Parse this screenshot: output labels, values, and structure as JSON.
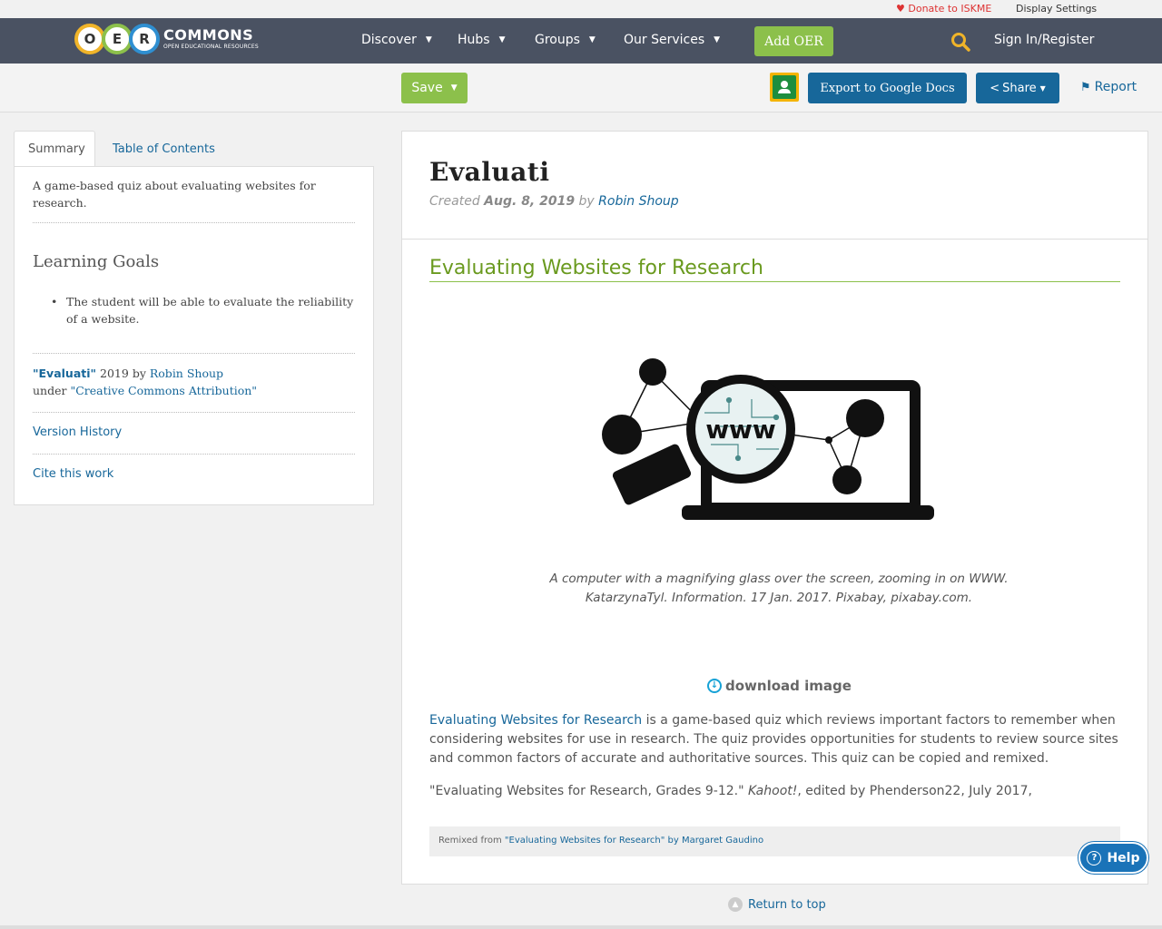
{
  "util": {
    "donate": "Donate to ISKME",
    "display_settings": "Display Settings"
  },
  "logo": {
    "letters": [
      "O",
      "E",
      "R"
    ],
    "word": "COMMONS",
    "sub": "OPEN EDUCATIONAL RESOURCES"
  },
  "nav": {
    "items": [
      "Discover",
      "Hubs",
      "Groups",
      "Our Services"
    ],
    "add_oer": "Add OER",
    "sign_in": "Sign In/Register"
  },
  "actions": {
    "save": "Save",
    "export": "Export to Google Docs",
    "share": "Share",
    "report": "Report"
  },
  "sidebar": {
    "tabs": [
      "Summary",
      "Table of Contents"
    ],
    "summary": "A game-based quiz about evaluating websites for research.",
    "goals_heading": "Learning Goals",
    "goals": [
      "The student will be able to evaluate the reliability of a website."
    ],
    "attribution": {
      "title": "\"Evaluati\"",
      "year": "2019",
      "by": "by",
      "author": "Robin Shoup",
      "under": "under",
      "license": "\"Creative Commons Attribution\""
    },
    "version_history": "Version History",
    "cite": "Cite this work"
  },
  "main": {
    "title": "Evaluati",
    "created_label": "Created",
    "created_date": "Aug. 8, 2019",
    "by": "by",
    "author": "Robin Shoup",
    "section_title": "Evaluating Websites for Research",
    "hero_text": "www",
    "caption_line1": "A computer with a magnifying glass over the screen, zooming in on WWW.",
    "caption_line2": "KatarzynaTyl. Information. 17 Jan. 2017. Pixabay, pixabay.com.",
    "download": "download image",
    "p1_link": "Evaluating Websites for Research",
    "p1_rest": " is a game-based quiz which reviews important factors to remember when considering websites for use in research. The quiz provides opportunities for students to review source sites and common factors of accurate and authoritative sources. This quiz can be copied and remixed.",
    "p2_a": "\"Evaluating Websites for Research, Grades 9-12.\" ",
    "p2_em": "Kahoot!",
    "p2_b": ", edited by Phenderson22, July 2017,",
    "remix_label": "Remixed from ",
    "remix_link": "\"Evaluating Websites for Research\" by Margaret Gaudino"
  },
  "help": "Help",
  "return_top": "Return to top",
  "colors": {
    "nav_bg": "#4a5262",
    "green": "#8cc04b",
    "blue": "#17679a"
  }
}
